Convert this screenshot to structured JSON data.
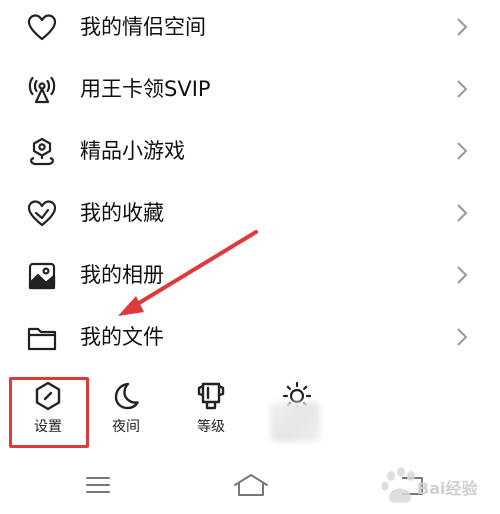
{
  "menu": {
    "items": [
      {
        "label": "我的情侣空间",
        "icon": "heart-icon"
      },
      {
        "label": "用王卡领SVIP",
        "icon": "broadcast-tower-icon"
      },
      {
        "label": "精品小游戏",
        "icon": "location-pin-icon"
      },
      {
        "label": "我的收藏",
        "icon": "favorite-heart-icon"
      },
      {
        "label": "我的相册",
        "icon": "photo-album-icon"
      },
      {
        "label": "我的文件",
        "icon": "folder-icon"
      }
    ]
  },
  "quickbar": {
    "items": [
      {
        "label": "设置",
        "icon": "settings-hexagon-icon"
      },
      {
        "label": "夜间",
        "icon": "moon-icon"
      },
      {
        "label": "等级",
        "icon": "trophy-icon"
      },
      {
        "label": "",
        "icon": "sun-icon"
      }
    ]
  },
  "navbar": {
    "items": [
      {
        "icon": "menu-icon"
      },
      {
        "icon": "home-icon"
      },
      {
        "icon": "back-icon"
      }
    ]
  },
  "annotation": {
    "color": "#e0393b"
  },
  "watermark": {
    "text": "Bai经验"
  }
}
